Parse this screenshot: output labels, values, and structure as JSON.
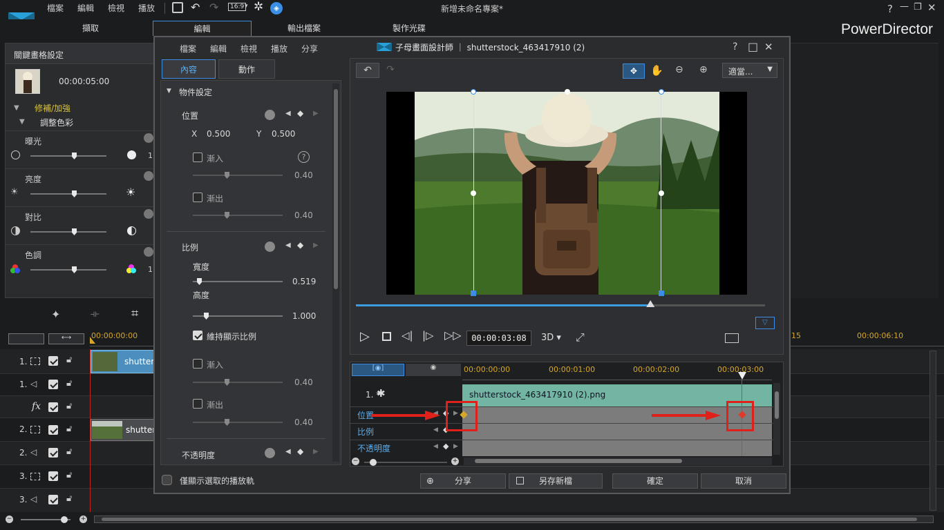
{
  "app": {
    "menu": [
      "檔案",
      "編輯",
      "檢視",
      "播放"
    ],
    "title": "新增未命名專案*",
    "brand": "PowerDirector",
    "aspect": "16:9",
    "main_tabs": [
      "擷取",
      "編輯",
      "輸出檔案",
      "製作光碟"
    ],
    "window_controls": [
      "?",
      "—",
      "❐",
      "✕"
    ]
  },
  "left_panel": {
    "title": "關鍵畫格設定",
    "clip_time": "00:00:05:00",
    "section": "修補/加強",
    "subsection": "調整色彩",
    "rows": [
      {
        "label": "曝光",
        "num": "1"
      },
      {
        "label": "亮度",
        "num": ""
      },
      {
        "label": "對比",
        "num": ""
      },
      {
        "label": "色調",
        "num": "1"
      }
    ]
  },
  "timeline": {
    "start_time": "00:00:00:00",
    "right_times": [
      "15",
      "00:00:06:10"
    ],
    "tracks": [
      {
        "num": "1.",
        "type": "video",
        "clip": "shutters"
      },
      {
        "num": "1.",
        "type": "audio",
        "clip": ""
      },
      {
        "num": "fx",
        "type": "fx",
        "clip": ""
      },
      {
        "num": "2.",
        "type": "video",
        "clip": "shutters"
      },
      {
        "num": "2.",
        "type": "audio",
        "clip": ""
      },
      {
        "num": "3.",
        "type": "video",
        "clip": ""
      },
      {
        "num": "3.",
        "type": "audio",
        "clip": ""
      }
    ]
  },
  "dialog": {
    "menu": [
      "檔案",
      "編輯",
      "檢視",
      "播放",
      "分享"
    ],
    "title": "子母畫面設計師 ｜ shutterstock_463417910 (2)",
    "tabs": [
      "內容",
      "動作"
    ],
    "section": "物件設定",
    "position": {
      "label": "位置",
      "x_label": "X",
      "x_value": "0.500",
      "y_label": "Y",
      "y_value": "0.500",
      "fade_in": "漸入",
      "fade_in_value": "0.40",
      "fade_out": "漸出",
      "fade_out_value": "0.40",
      "help": "?"
    },
    "scale": {
      "label": "比例",
      "width_label": "寬度",
      "width_value": "0.519",
      "height_label": "高度",
      "height_value": "1.000",
      "keep_ratio": "維持顯示比例",
      "fade_in": "漸入",
      "fade_in_value": "0.40",
      "fade_out": "漸出",
      "fade_out_value": "0.40"
    },
    "opacity_label": "不透明度",
    "only_selected": "僅顯示選取的播放軌",
    "zoom_select": "適當...",
    "preview_progress": 0.72,
    "playback_time": "00:00:03:08",
    "mode_3d": "3D",
    "kf_times": [
      "00:00:00:00",
      "00:00:01:00",
      "00:00:02:00",
      "00:00:03:00"
    ],
    "track_label": "1. *",
    "clip_name": "shutterstock_463417910 (2).png",
    "kf_rows": [
      "位置",
      "比例",
      "不透明度"
    ],
    "buttons": {
      "share": "分享",
      "save_as": "另存新檔",
      "ok": "確定",
      "cancel": "取消"
    },
    "window_controls": [
      "?",
      "□",
      "✕"
    ]
  }
}
